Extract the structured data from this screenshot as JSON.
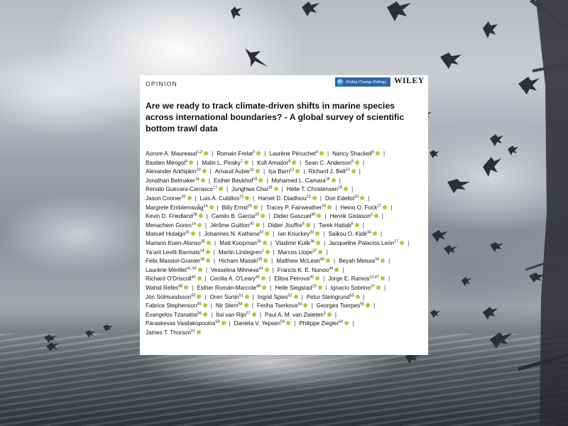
{
  "card": {
    "section_label": "OPINION",
    "journal_name": "Global Change Biology",
    "publisher": "WILEY",
    "title": "Are we ready to track climate-driven shifts in marine species across international boundaries? - A global survey of scientific bottom trawl data"
  },
  "colors": {
    "journal_badge": "#2c66a8",
    "orcid": "#a6ce39"
  },
  "icons": {
    "journal_logo": "globe-icon",
    "orcid": "orcid-icon"
  },
  "author_lines": [
    [
      {
        "name": "Aurore A. Maureaud",
        "aff": "1,2"
      },
      {
        "name": "Romain Frelat",
        "aff": "3"
      },
      {
        "name": "Laurène Pécuchet",
        "aff": "4"
      },
      {
        "name": "Nancy Shackell",
        "aff": "5"
      }
    ],
    [
      {
        "name": "Bastien Mérigot",
        "aff": "6"
      },
      {
        "name": "Malin L. Pinsky",
        "aff": "7"
      },
      {
        "name": "Kofi Amador",
        "aff": "8"
      },
      {
        "name": "Sean C. Anderson",
        "aff": "9"
      }
    ],
    [
      {
        "name": "Alexander Arkhipkin",
        "aff": "10"
      },
      {
        "name": "Arnaud Auber",
        "aff": "11"
      },
      {
        "name": "Iça Barri",
        "aff": "12"
      },
      {
        "name": "Richard J. Bell",
        "aff": "13"
      }
    ],
    [
      {
        "name": "Jonathan Belmaker",
        "aff": "14"
      },
      {
        "name": "Esther Beukhof",
        "aff": "15"
      },
      {
        "name": "Mohamed L. Camara",
        "aff": "16"
      }
    ],
    [
      {
        "name": "Renato Guevara-Carrasco",
        "aff": "17"
      },
      {
        "name": "Junghwa Choi",
        "aff": "18"
      },
      {
        "name": "Helle T. Christensen",
        "aff": "19"
      }
    ],
    [
      {
        "name": "Jason Conner",
        "aff": "20"
      },
      {
        "name": "Luis A. Cubillos",
        "aff": "21"
      },
      {
        "name": "Hamet D. Diadhiou",
        "aff": "22"
      },
      {
        "name": "Dori Edelist",
        "aff": "23"
      }
    ],
    [
      {
        "name": "Margrete Emblemsvåg",
        "aff": "24"
      },
      {
        "name": "Billy Ernst",
        "aff": "25"
      },
      {
        "name": "Tracey P. Fairweather",
        "aff": "26"
      },
      {
        "name": "Heino O. Fock",
        "aff": "27"
      }
    ],
    [
      {
        "name": "Kevin D. Friedland",
        "aff": "28"
      },
      {
        "name": "Camilo B. Garcia",
        "aff": "29"
      },
      {
        "name": "Didier Gascuel",
        "aff": "30"
      },
      {
        "name": "Henrik Gislason",
        "aff": "2"
      }
    ],
    [
      {
        "name": "Menachem Goren",
        "aff": "14"
      },
      {
        "name": "Jérôme Guitton",
        "aff": "30"
      },
      {
        "name": "Didier Jouffre",
        "aff": "6"
      },
      {
        "name": "Tarek Hattab",
        "aff": "6"
      }
    ],
    [
      {
        "name": "Manuel Hidalgo",
        "aff": "31"
      },
      {
        "name": "Johannes N. Kathena",
        "aff": "32"
      },
      {
        "name": "Ian Knuckey",
        "aff": "33"
      },
      {
        "name": "Saïkou O. Kidé",
        "aff": "34"
      }
    ],
    [
      {
        "name": "Mariano Koen-Alonso",
        "aff": "35"
      },
      {
        "name": "Matt Koopman",
        "aff": "33"
      },
      {
        "name": "Vladimir Kulik",
        "aff": "36"
      },
      {
        "name": "Jacqueline Palacios León",
        "aff": "17"
      }
    ],
    [
      {
        "name": "Ya'arit Levitt-Barmats",
        "aff": "14"
      },
      {
        "name": "Martin Lindegren",
        "aff": "1"
      },
      {
        "name": "Marcos Llope",
        "aff": "37"
      }
    ],
    [
      {
        "name": "Félix Massiot-Granier",
        "aff": "38"
      },
      {
        "name": "Hicham Masski",
        "aff": "39"
      },
      {
        "name": "Matthew McLean",
        "aff": "40"
      },
      {
        "name": "Beyah Meissa",
        "aff": "34"
      }
    ],
    [
      {
        "name": "Laurène Mérillet",
        "aff": "41,42"
      },
      {
        "name": "Vesselina Mihneva",
        "aff": "43"
      },
      {
        "name": "Francis K. E. Nunoo",
        "aff": "44"
      }
    ],
    [
      {
        "name": "Richard O'Driscoll",
        "aff": "45"
      },
      {
        "name": "Cecilia A. O'Leary",
        "aff": "46"
      },
      {
        "name": "Elitsa Petrova",
        "aff": "43"
      },
      {
        "name": "Jorge E. Ramos",
        "aff": "10,47"
      }
    ],
    [
      {
        "name": "Wahid Refes",
        "aff": "48"
      },
      {
        "name": "Esther Román-Marcote",
        "aff": "49"
      },
      {
        "name": "Helle Siegstad",
        "aff": "19"
      },
      {
        "name": "Ignacio Sobrino",
        "aff": "37"
      }
    ],
    [
      {
        "name": "Jón Sólmundsson",
        "aff": "50"
      },
      {
        "name": "Oren Sonin",
        "aff": "51"
      },
      {
        "name": "Ingrid Spies",
        "aff": "52"
      },
      {
        "name": "Petur Steingrund",
        "aff": "53"
      }
    ],
    [
      {
        "name": "Fabrice Stephenson",
        "aff": "45"
      },
      {
        "name": "Nir Stern",
        "aff": "54"
      },
      {
        "name": "Feriha Tserkova",
        "aff": "43"
      },
      {
        "name": "Georges Tserpes",
        "aff": "55"
      }
    ],
    [
      {
        "name": "Evangelos Tzanatos",
        "aff": "56"
      },
      {
        "name": "Itai van Rijn",
        "aff": "57"
      },
      {
        "name": "Paul A. M. van Zwieten",
        "aff": "3"
      }
    ],
    [
      {
        "name": "Paraskevas Vasilakopoulos",
        "aff": "58"
      },
      {
        "name": "Daniela V. Yepsen",
        "aff": "59"
      },
      {
        "name": "Philippe Ziegler",
        "aff": "60"
      }
    ],
    [
      {
        "name": "James T. Thorson",
        "aff": "61"
      }
    ]
  ],
  "author_lines_trailing_sep": [
    true,
    true,
    true,
    true,
    true,
    true,
    true,
    true,
    true,
    true,
    true,
    true,
    true,
    true,
    true,
    true,
    true,
    true,
    true,
    true,
    false
  ]
}
